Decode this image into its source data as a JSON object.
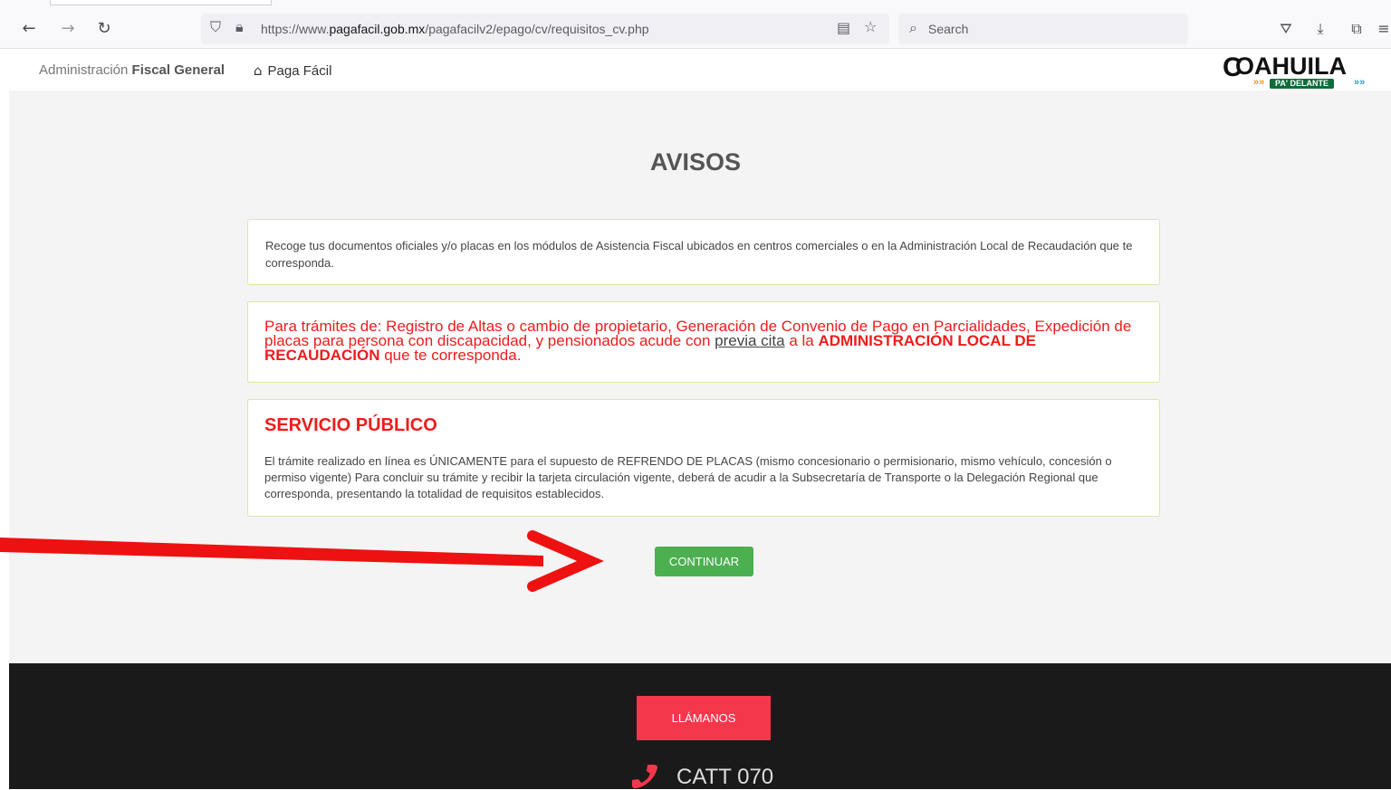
{
  "browser": {
    "url_prefix": "https://www.",
    "url_domain": "pagafacil.gob.mx",
    "url_path": "/pagafacilv2/epago/cv/requisitos_cv.php",
    "search_placeholder": "Search"
  },
  "header": {
    "brand_light": "Administración",
    "brand_bold": "Fiscal General",
    "home_label": "Paga Fácil",
    "logo_text": "OAHUILA",
    "logo_letter": "C",
    "logo_tagline": "PA' DELANTE"
  },
  "main": {
    "title": "AVISOS",
    "notice1": "Recoge tus documentos oficiales y/o placas en los módulos de Asistencia Fiscal ubicados en centros comerciales o en la Administración Local de Recaudación que te corresponda.",
    "notice2": {
      "part1": "Para trámites de: Registro de Altas o cambio de propietario, Generación de Convenio de Pago en Parcialidades, Expedición de placas para persona con discapacidad, y pensionados acude con ",
      "link": "previa cita",
      "part2": " a la ",
      "strong": "ADMINISTRACIÓN LOCAL DE RECAUDACIÓN",
      "part3": " que te corresponda."
    },
    "notice3": {
      "title": "SERVICIO PÚBLICO",
      "text": "El trámite realizado en línea es ÚNICAMENTE para el supuesto de REFRENDO DE PLACAS (mismo concesionario o permisionario, mismo vehículo, concesión o permiso vigente) Para concluir su trámite y recibir la tarjeta circulación vigente, deberá de acudir a la Subsecretaría de Transporte o la Delegación Regional que corresponda, presentando la totalidad de requisitos establecidos."
    },
    "continue_label": "CONTINUAR"
  },
  "footer": {
    "call_label": "LLÁMANOS",
    "phone_text": "CATT 070"
  },
  "colors": {
    "accent_green": "#4caf50",
    "alert_red": "#ee1c1c",
    "call_red": "#f5374c",
    "annotation_arrow": "#ee1111"
  },
  "icons": [
    "back-icon",
    "forward-icon",
    "reload-icon",
    "shield-icon",
    "lock-icon",
    "reader-view-icon",
    "bookmark-star-icon",
    "search-icon",
    "pocket-icon",
    "download-icon",
    "extensions-icon",
    "menu-icon",
    "home-icon",
    "phone-icon"
  ]
}
